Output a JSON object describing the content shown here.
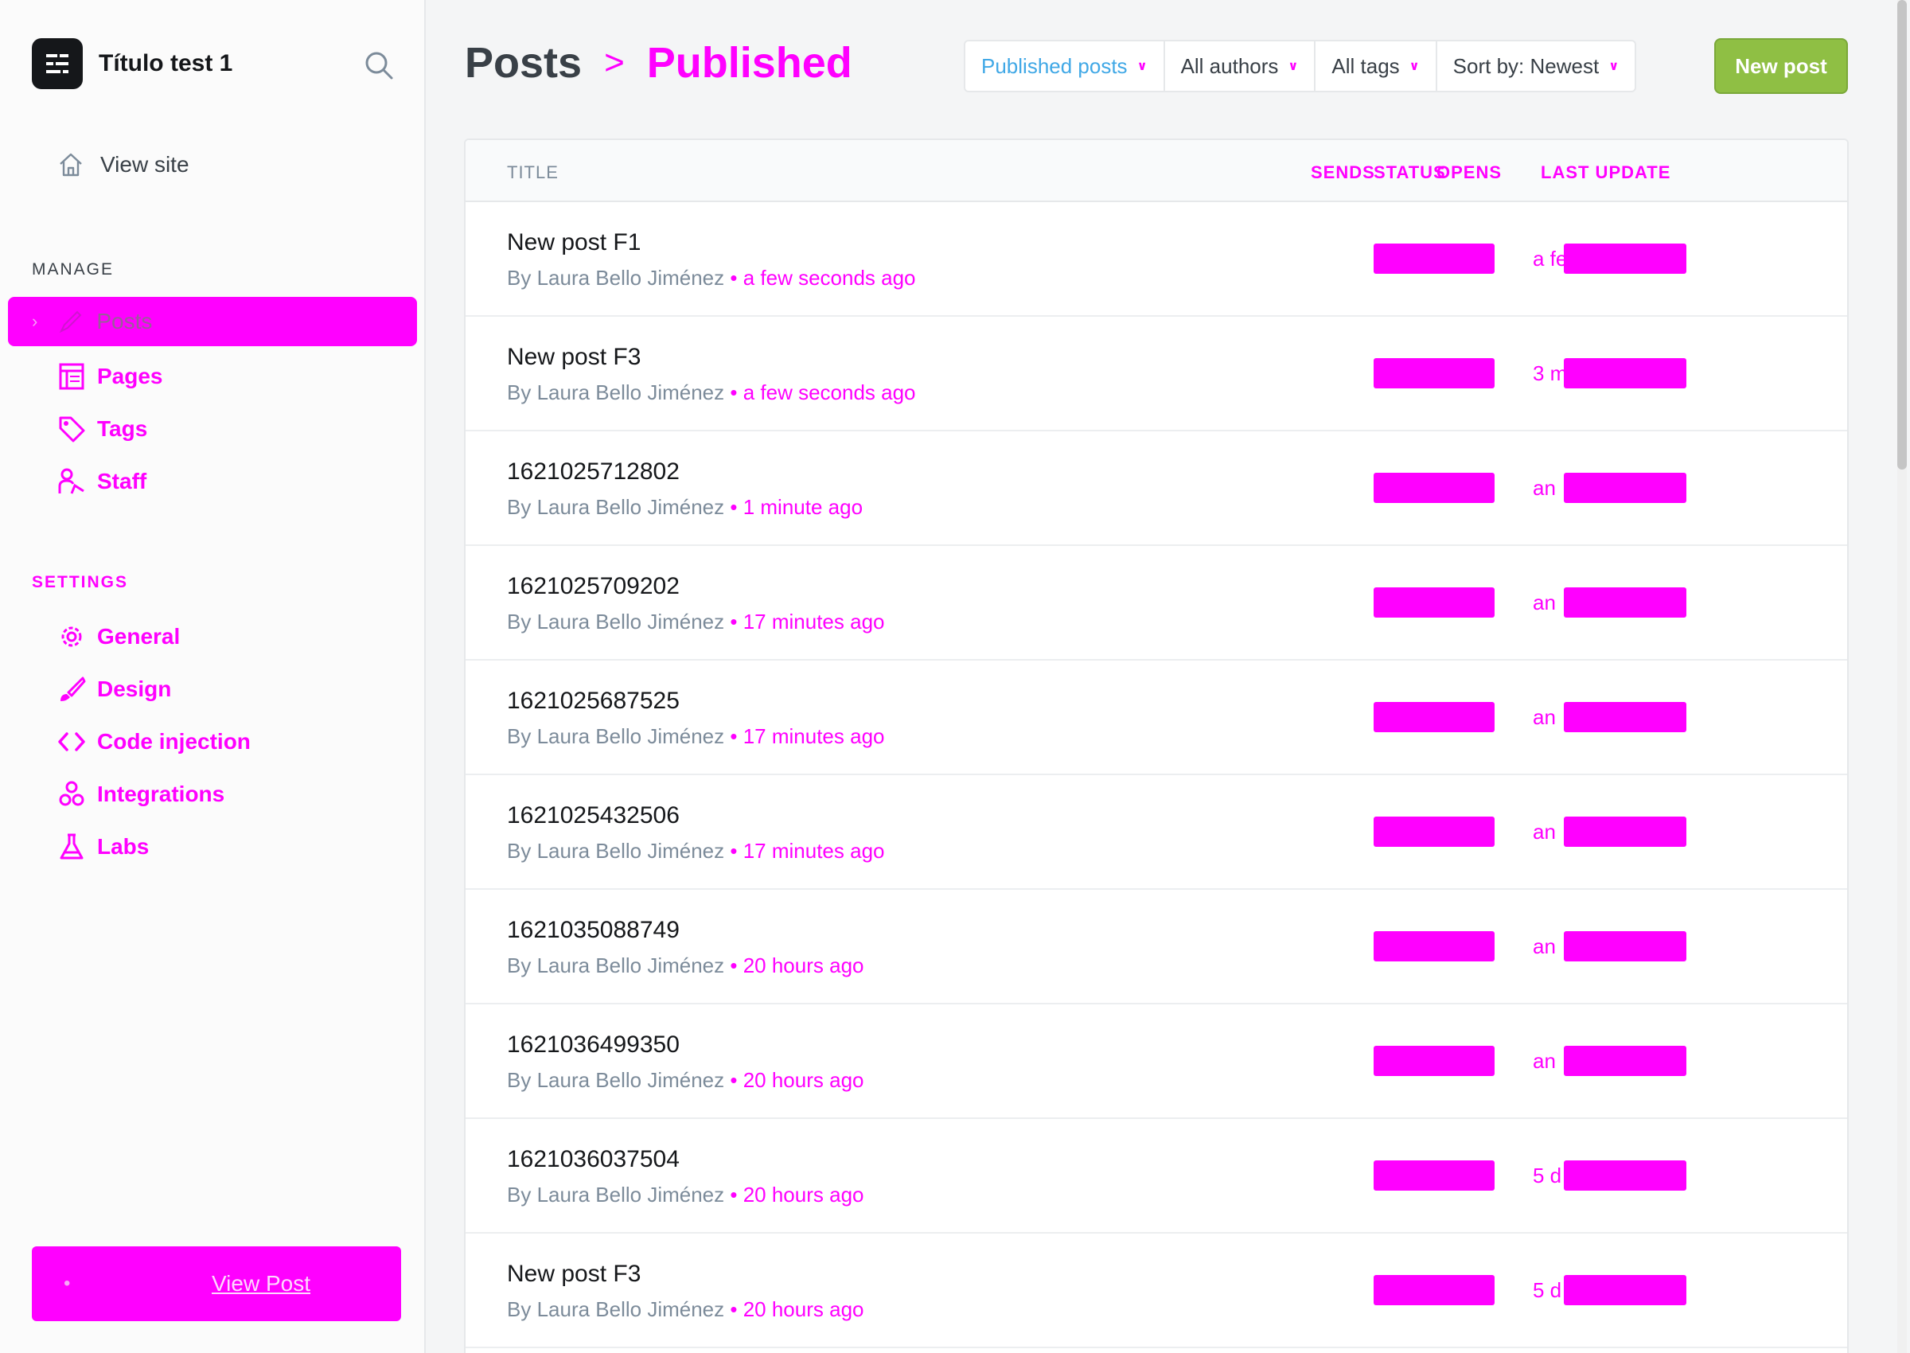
{
  "sidebar": {
    "site_title": "Título test 1",
    "view_site": "View site",
    "manage_label": "MANAGE",
    "settings_label": "SETTINGS",
    "manage_items": [
      {
        "label": "Posts",
        "icon": "posts-icon"
      },
      {
        "label": "Pages",
        "icon": "pages-icon"
      },
      {
        "label": "Tags",
        "icon": "tag-icon"
      },
      {
        "label": "Staff",
        "icon": "staff-icon"
      }
    ],
    "settings_items": [
      {
        "label": "General",
        "icon": "gear-icon"
      },
      {
        "label": "Design",
        "icon": "brush-icon"
      },
      {
        "label": "Code injection",
        "icon": "code-icon"
      },
      {
        "label": "Integrations",
        "icon": "integrations-icon"
      },
      {
        "label": "Labs",
        "icon": "flask-icon"
      }
    ],
    "view_post": "View Post"
  },
  "header": {
    "title": "Posts",
    "separator": ">",
    "subtitle": "Published",
    "filters": {
      "type": "Published posts",
      "authors": "All authors",
      "tags": "All tags",
      "sort": "Sort by: Newest"
    },
    "new_post": "New post"
  },
  "table": {
    "columns": {
      "title": "TITLE",
      "sends": "SENDS",
      "status": "STATUS",
      "opens": "OPENS",
      "last_update": "LAST UPDATE"
    },
    "rows": [
      {
        "title": "New post F1",
        "author": "By Laura Bello Jiménez",
        "time": "a few seconds ago",
        "date_prefix": "a fe"
      },
      {
        "title": "New post F3",
        "author": "By Laura Bello Jiménez",
        "time": "a few seconds ago",
        "date_prefix": "3 m"
      },
      {
        "title": "1621025712802",
        "author": "By Laura Bello Jiménez",
        "time": "1 minute ago",
        "date_prefix": "an"
      },
      {
        "title": "1621025709202",
        "author": "By Laura Bello Jiménez",
        "time": "17 minutes ago",
        "date_prefix": "an"
      },
      {
        "title": "1621025687525",
        "author": "By Laura Bello Jiménez",
        "time": "17 minutes ago",
        "date_prefix": "an"
      },
      {
        "title": "1621025432506",
        "author": "By Laura Bello Jiménez",
        "time": "17 minutes ago",
        "date_prefix": "an"
      },
      {
        "title": "1621035088749",
        "author": "By Laura Bello Jiménez",
        "time": "20 hours ago",
        "date_prefix": "an"
      },
      {
        "title": "1621036499350",
        "author": "By Laura Bello Jiménez",
        "time": "20 hours ago",
        "date_prefix": "an"
      },
      {
        "title": "1621036037504",
        "author": "By Laura Bello Jiménez",
        "time": "20 hours ago",
        "date_prefix": "5 d"
      },
      {
        "title": "New post F3",
        "author": "By Laura Bello Jiménez",
        "time": "20 hours ago",
        "date_prefix": "5 d"
      }
    ]
  },
  "colors": {
    "accent": "#ff00ff",
    "primary_button": "#8fbf44",
    "link_blue": "#40a8e6"
  }
}
